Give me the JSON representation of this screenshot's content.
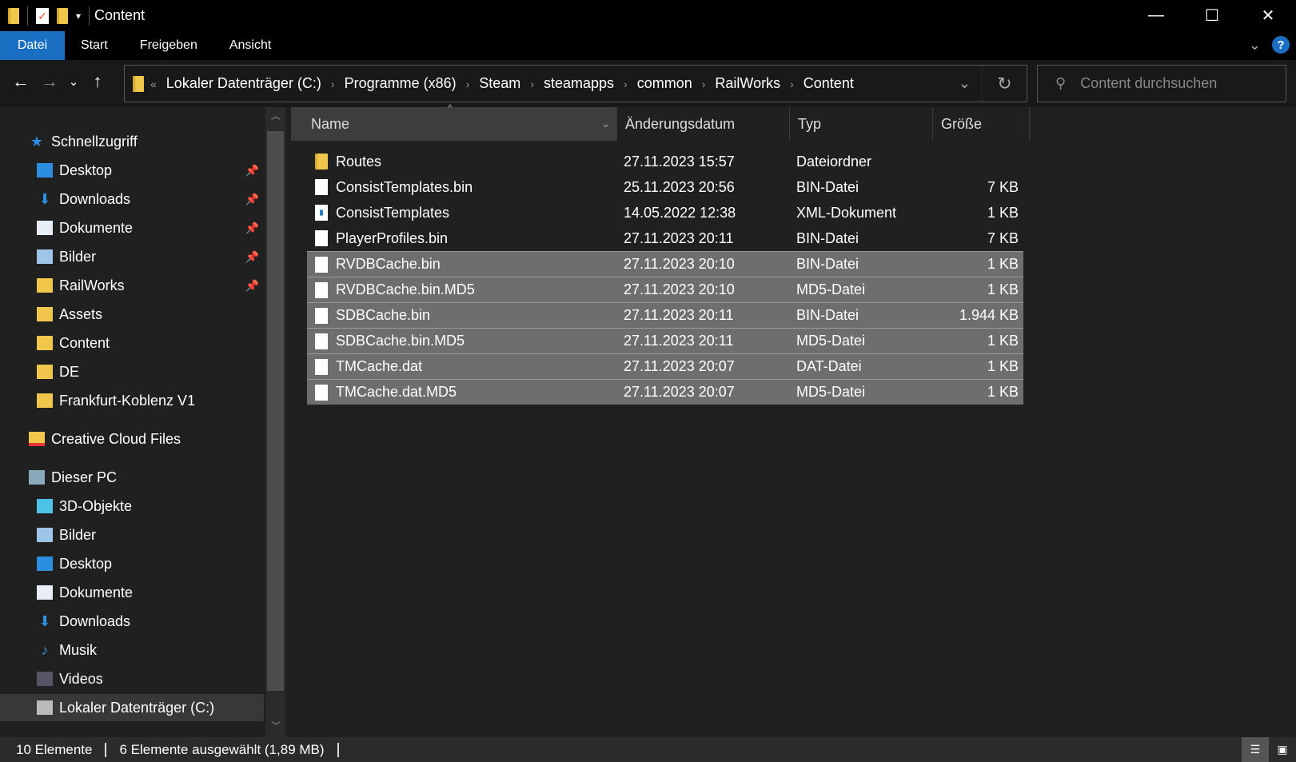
{
  "window": {
    "title": "Content"
  },
  "ribbon": {
    "tabs": [
      "Datei",
      "Start",
      "Freigeben",
      "Ansicht"
    ],
    "help": "?"
  },
  "address": {
    "crumbs": [
      "Lokaler Datenträger (C:)",
      "Programme (x86)",
      "Steam",
      "steamapps",
      "common",
      "RailWorks",
      "Content"
    ]
  },
  "search": {
    "placeholder": "Content durchsuchen"
  },
  "sidebar": {
    "quick_access": "Schnellzugriff",
    "quick_items": [
      {
        "label": "Desktop",
        "icon": "desktop-icon",
        "pinned": true
      },
      {
        "label": "Downloads",
        "icon": "download-icon",
        "pinned": true
      },
      {
        "label": "Dokumente",
        "icon": "document-icon",
        "pinned": true
      },
      {
        "label": "Bilder",
        "icon": "pictures-icon",
        "pinned": true
      },
      {
        "label": "RailWorks",
        "icon": "folder-icon",
        "pinned": true
      },
      {
        "label": "Assets",
        "icon": "folder-icon"
      },
      {
        "label": "Content",
        "icon": "folder-icon"
      },
      {
        "label": "DE",
        "icon": "folder-icon"
      },
      {
        "label": "Frankfurt-Koblenz V1",
        "icon": "folder-icon"
      }
    ],
    "creative_cloud": "Creative Cloud Files",
    "this_pc": "Dieser PC",
    "pc_items": [
      {
        "label": "3D-Objekte",
        "icon": "3d-objects-icon"
      },
      {
        "label": "Bilder",
        "icon": "pictures-icon"
      },
      {
        "label": "Desktop",
        "icon": "desktop-icon"
      },
      {
        "label": "Dokumente",
        "icon": "document-icon"
      },
      {
        "label": "Downloads",
        "icon": "download-icon"
      },
      {
        "label": "Musik",
        "icon": "music-icon"
      },
      {
        "label": "Videos",
        "icon": "video-icon"
      },
      {
        "label": "Lokaler Datenträger (C:)",
        "icon": "drive-icon",
        "selected": true
      }
    ]
  },
  "columns": [
    "Name",
    "Änderungsdatum",
    "Typ",
    "Größe"
  ],
  "files": [
    {
      "name": "Routes",
      "date": "27.11.2023 15:57",
      "type": "Dateiordner",
      "size": "",
      "kind": "folder",
      "selected": false
    },
    {
      "name": "ConsistTemplates.bin",
      "date": "25.11.2023 20:56",
      "type": "BIN-Datei",
      "size": "7 KB",
      "kind": "file",
      "selected": false
    },
    {
      "name": "ConsistTemplates",
      "date": "14.05.2022 12:38",
      "type": "XML-Dokument",
      "size": "1 KB",
      "kind": "xml",
      "selected": false
    },
    {
      "name": "PlayerProfiles.bin",
      "date": "27.11.2023 20:11",
      "type": "BIN-Datei",
      "size": "7 KB",
      "kind": "file",
      "selected": false
    },
    {
      "name": "RVDBCache.bin",
      "date": "27.11.2023 20:10",
      "type": "BIN-Datei",
      "size": "1 KB",
      "kind": "file",
      "selected": true
    },
    {
      "name": "RVDBCache.bin.MD5",
      "date": "27.11.2023 20:10",
      "type": "MD5-Datei",
      "size": "1 KB",
      "kind": "file",
      "selected": true
    },
    {
      "name": "SDBCache.bin",
      "date": "27.11.2023 20:11",
      "type": "BIN-Datei",
      "size": "1.944 KB",
      "kind": "file",
      "selected": true
    },
    {
      "name": "SDBCache.bin.MD5",
      "date": "27.11.2023 20:11",
      "type": "MD5-Datei",
      "size": "1 KB",
      "kind": "file",
      "selected": true
    },
    {
      "name": "TMCache.dat",
      "date": "27.11.2023 20:07",
      "type": "DAT-Datei",
      "size": "1 KB",
      "kind": "file",
      "selected": true
    },
    {
      "name": "TMCache.dat.MD5",
      "date": "27.11.2023 20:07",
      "type": "MD5-Datei",
      "size": "1 KB",
      "kind": "file",
      "selected": true
    }
  ],
  "status": {
    "count": "10 Elemente",
    "selection": "6 Elemente ausgewählt (1,89 MB)"
  },
  "colors": {
    "accent": "#1a6fc2",
    "selection": "#6e6e6e",
    "folder": "#f1c74b"
  }
}
